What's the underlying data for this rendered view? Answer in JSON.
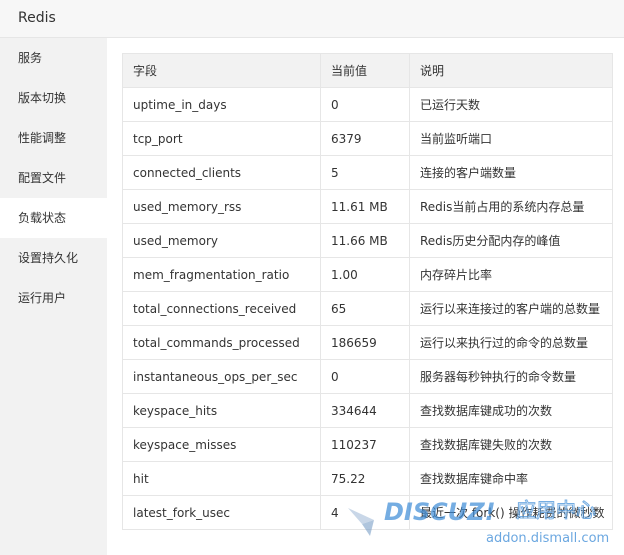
{
  "app": {
    "title": "Redis"
  },
  "sidebar": {
    "items": [
      {
        "label": "服务",
        "name": "sidebar-item-service",
        "active": false
      },
      {
        "label": "版本切换",
        "name": "sidebar-item-version-switch",
        "active": false
      },
      {
        "label": "性能调整",
        "name": "sidebar-item-performance",
        "active": false
      },
      {
        "label": "配置文件",
        "name": "sidebar-item-config-file",
        "active": false
      },
      {
        "label": "负载状态",
        "name": "sidebar-item-load-status",
        "active": true
      },
      {
        "label": "设置持久化",
        "name": "sidebar-item-persistence",
        "active": false
      },
      {
        "label": "运行用户",
        "name": "sidebar-item-run-user",
        "active": false
      }
    ]
  },
  "table": {
    "headers": [
      "字段",
      "当前值",
      "说明"
    ],
    "rows": [
      [
        "uptime_in_days",
        "0",
        "已运行天数"
      ],
      [
        "tcp_port",
        "6379",
        "当前监听端口"
      ],
      [
        "connected_clients",
        "5",
        "连接的客户端数量"
      ],
      [
        "used_memory_rss",
        "11.61 MB",
        "Redis当前占用的系统内存总量"
      ],
      [
        "used_memory",
        "11.66 MB",
        "Redis历史分配内存的峰值"
      ],
      [
        "mem_fragmentation_ratio",
        "1.00",
        "内存碎片比率"
      ],
      [
        "total_connections_received",
        "65",
        "运行以来连接过的客户端的总数量"
      ],
      [
        "total_commands_processed",
        "186659",
        "运行以来执行过的命令的总数量"
      ],
      [
        "instantaneous_ops_per_sec",
        "0",
        "服务器每秒钟执行的命令数量"
      ],
      [
        "keyspace_hits",
        "334644",
        "查找数据库键成功的次数"
      ],
      [
        "keyspace_misses",
        "110237",
        "查找数据库键失败的次数"
      ],
      [
        "hit",
        "75.22",
        "查找数据库键命中率"
      ],
      [
        "latest_fork_usec",
        "4",
        "最近一次 fork() 操作耗费的微秒数"
      ]
    ]
  },
  "watermark": {
    "brand": "DISCUZ!",
    "subtitle": "应用中心",
    "url": "addon.dismall.com"
  },
  "colors": {
    "titlebar_bg": "#f7f7f7",
    "sidebar_bg": "#f2f2f2",
    "header_bg": "#f2f2f2",
    "border": "#e6e6e6",
    "text": "#333333",
    "watermark_blue": "#3a8ad6"
  },
  "icons": [
    "discuz-logo-icon"
  ]
}
